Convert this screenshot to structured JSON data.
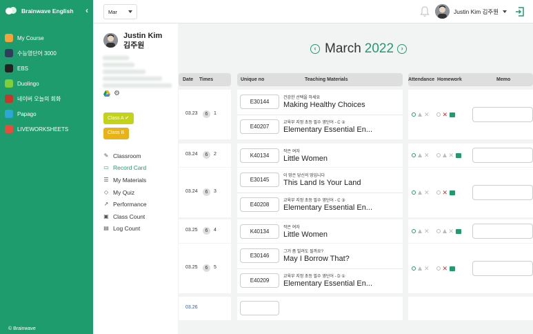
{
  "app": {
    "name": "Brainwave English",
    "footer": "© Brainwave"
  },
  "nav": [
    {
      "label": "My Course",
      "icon": "home-icon",
      "color": "#f4a23a"
    },
    {
      "label": "수능영단어 3000",
      "icon": "globe-icon",
      "color": "#2e3e5c"
    },
    {
      "label": "EBS",
      "icon": "ebs-icon",
      "color": "#222"
    },
    {
      "label": "Duolingo",
      "icon": "duolingo-icon",
      "color": "#7fce3a"
    },
    {
      "label": "네이버 오늘의 회화",
      "icon": "naver-icon",
      "color": "#c0392b"
    },
    {
      "label": "Papago",
      "icon": "papago-icon",
      "color": "#2ea6d6"
    },
    {
      "label": "LIVEWORKSHEETS",
      "icon": "liveworksheets-icon",
      "color": "#e74c3c"
    }
  ],
  "topbar": {
    "month": "Mar",
    "user": "Justin Kim 김주원"
  },
  "profile": {
    "name_en": "Justin Kim",
    "name_ko": "김주원",
    "classes": [
      "Class A ✔",
      "Class B"
    ],
    "menu": [
      {
        "label": "Classroom",
        "icon": "classroom-icon"
      },
      {
        "label": "Record Card",
        "icon": "record-card-icon",
        "active": true
      },
      {
        "label": "My Materials",
        "icon": "materials-icon"
      },
      {
        "label": "My Quiz",
        "icon": "quiz-icon"
      },
      {
        "label": "Performance",
        "icon": "performance-icon"
      },
      {
        "label": "Class Count",
        "icon": "class-count-icon"
      },
      {
        "label": "Log Count",
        "icon": "log-count-icon"
      }
    ]
  },
  "header": {
    "month": "March",
    "year": "2022"
  },
  "columns": {
    "date": "Date",
    "times": "Times",
    "unique": "Unique no",
    "materials": "Teaching Materials",
    "attendance": "Attendance",
    "homework": "Homework",
    "memo": "Memo"
  },
  "rows": [
    {
      "date": "03.23",
      "badge": "6",
      "times": "1",
      "materials": [
        {
          "code": "E30144",
          "sub": "건강한 선택을 하세요",
          "title": "Making Healthy Choices"
        },
        {
          "code": "E40207",
          "sub": "교육부 지정 초등 필수 영단어 - C ②",
          "title": "Elementary Essential En..."
        }
      ]
    },
    {
      "date": "03.24",
      "badge": "6",
      "times": "2",
      "materials": [
        {
          "code": "K40134",
          "sub": "작은 여자",
          "title": "Little Women"
        }
      ]
    },
    {
      "date": "03.24",
      "badge": "6",
      "times": "3",
      "materials": [
        {
          "code": "E30145",
          "sub": "이 땅은 당신의 땅입니다",
          "title": "This Land Is Your Land"
        },
        {
          "code": "E40208",
          "sub": "교육부 지정 초등 필수 영단어 - C ③",
          "title": "Elementary Essential En..."
        }
      ]
    },
    {
      "date": "03.25",
      "badge": "6",
      "times": "4",
      "materials": [
        {
          "code": "K40134",
          "sub": "작은 여자",
          "title": "Little Women"
        }
      ]
    },
    {
      "date": "03.25",
      "badge": "6",
      "times": "5",
      "materials": [
        {
          "code": "E30146",
          "sub": "그거 좀 빌려도 될까요?",
          "title": "May I Borrow That?"
        },
        {
          "code": "E40209",
          "sub": "교육부 지정 초등 필수 영단어 - D ①",
          "title": "Elementary Essential En..."
        }
      ]
    },
    {
      "date": "03.26"
    }
  ]
}
